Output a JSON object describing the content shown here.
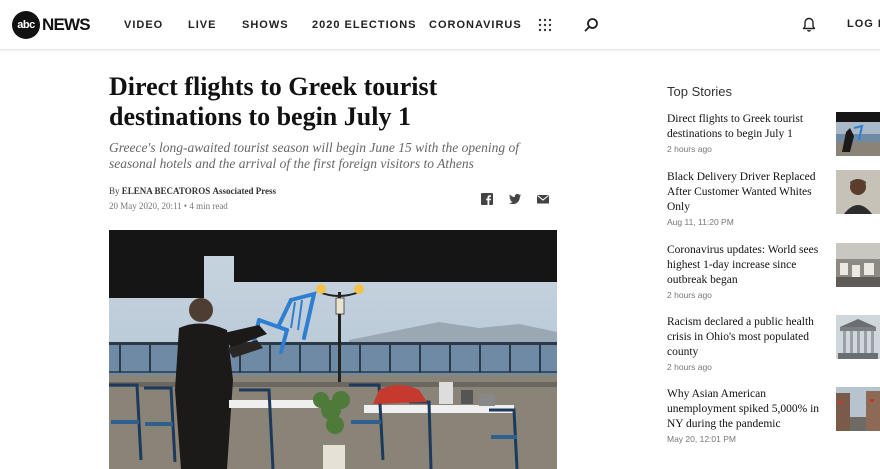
{
  "header": {
    "logo_badge": "abc",
    "logo_text": "NEWS",
    "nav": [
      {
        "label": "VIDEO"
      },
      {
        "label": "LIVE"
      },
      {
        "label": "SHOWS"
      },
      {
        "label": "2020 ELECTIONS"
      },
      {
        "label": "CORONAVIRUS"
      }
    ],
    "login_label": "LOG IN",
    "icons": [
      "grid-menu-icon",
      "search-icon",
      "bell-icon"
    ]
  },
  "article": {
    "headline": "Direct flights to Greek tourist destinations to begin July 1",
    "dek": "Greece's long-awaited tourist season will begin June 15 with the opening of seasonal hotels and the arrival of the first foreign visitors to Athens",
    "byline_prefix": "By",
    "author": "ELENA BECATOROS",
    "source": "Associated Press",
    "date": "20 May 2020, 20:11",
    "read_time": "• 4 min read",
    "share_icons": [
      "facebook-icon",
      "twitter-icon",
      "email-icon"
    ]
  },
  "sidebar": {
    "title": "Top Stories",
    "stories": [
      {
        "title": "Direct flights to Greek tourist destinations to begin July 1",
        "time": "2 hours ago"
      },
      {
        "title": "Black Delivery Driver Replaced After Customer Wanted Whites Only",
        "time": "Aug 11, 11:20 PM"
      },
      {
        "title": "Coronavirus updates: World sees highest 1-day increase since outbreak began",
        "time": "2 hours ago"
      },
      {
        "title": "Racism declared a public health crisis in Ohio's most populated county",
        "time": "2 hours ago"
      },
      {
        "title": "Why Asian American unemployment spiked 5,000% in NY during the pandemic",
        "time": "May 20, 12:01 PM"
      }
    ]
  },
  "colors": {
    "accent": "#111111",
    "meta": "#777777",
    "sea": "#6f8aa5",
    "chair_blue": "#2f7fd0"
  }
}
